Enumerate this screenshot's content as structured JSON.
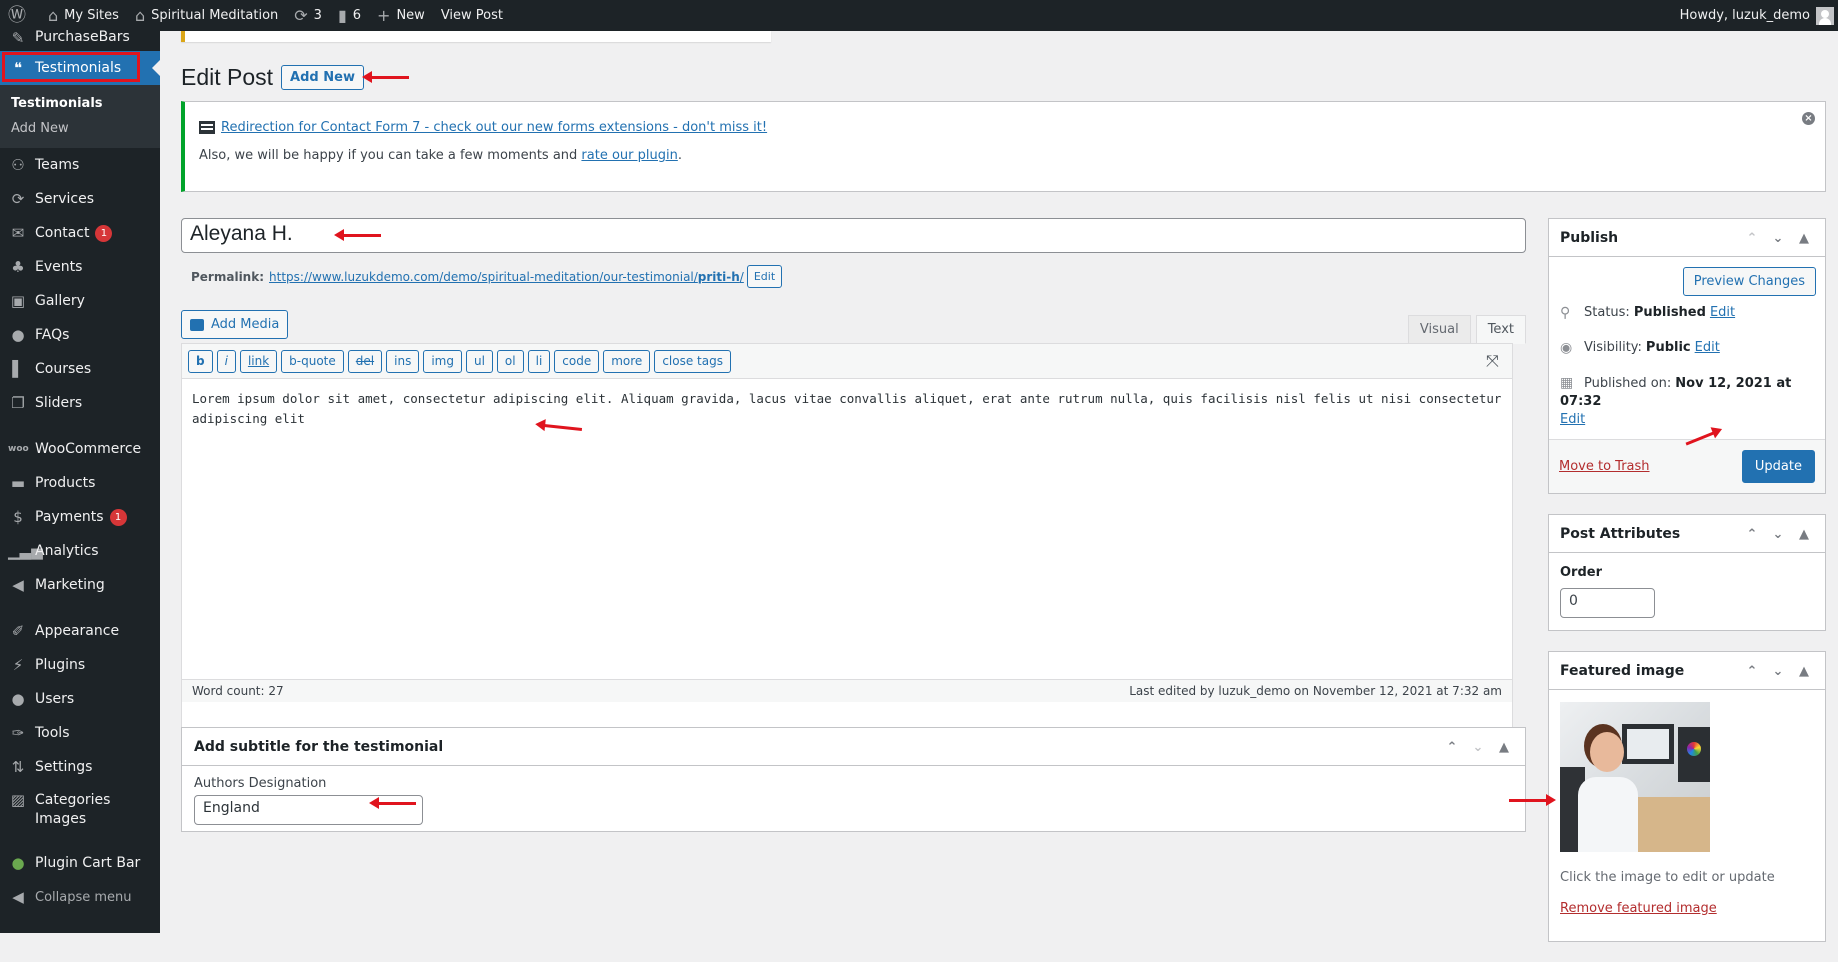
{
  "adminbar": {
    "wp_logo": "wordpress-logo-icon",
    "my_sites": "My Sites",
    "site_name": "Spiritual Meditation",
    "updates_count": "3",
    "comments_count": "6",
    "new_label": "New",
    "view_post": "View Post",
    "howdy": "Howdy, luzuk_demo"
  },
  "sidebar": {
    "items_top": [
      {
        "label": "PurchaseBars",
        "icon": "pushpin-icon"
      }
    ],
    "current": {
      "label": "Testimonials",
      "icon": "testimonial-icon"
    },
    "submenu": [
      "Testimonials",
      "Add New"
    ],
    "items_group1": [
      {
        "label": "Teams",
        "icon": "groups-icon"
      },
      {
        "label": "Services",
        "icon": "update-icon"
      },
      {
        "label": "Contact",
        "icon": "email-icon",
        "badge": "1"
      },
      {
        "label": "Events",
        "icon": "palmtree-icon"
      },
      {
        "label": "Gallery",
        "icon": "media-icon"
      },
      {
        "label": "FAQs",
        "icon": "chat-icon"
      },
      {
        "label": "Courses",
        "icon": "book-icon"
      },
      {
        "label": "Sliders",
        "icon": "slides-icon"
      }
    ],
    "items_group2": [
      {
        "label": "WooCommerce",
        "icon": "woo-icon"
      },
      {
        "label": "Products",
        "icon": "archive-icon"
      },
      {
        "label": "Payments",
        "icon": "money-icon",
        "badge": "1"
      },
      {
        "label": "Analytics",
        "icon": "chart-bar-icon"
      },
      {
        "label": "Marketing",
        "icon": "megaphone-icon"
      }
    ],
    "items_group3": [
      {
        "label": "Appearance",
        "icon": "brush-icon"
      },
      {
        "label": "Plugins",
        "icon": "plugin-icon"
      },
      {
        "label": "Users",
        "icon": "user-icon"
      },
      {
        "label": "Tools",
        "icon": "wrench-icon"
      },
      {
        "label": "Settings",
        "icon": "settings-icon"
      },
      {
        "label": "Categories Images",
        "icon": "image-icon"
      }
    ],
    "plugin_cart_bar": "Plugin Cart Bar",
    "collapse": "Collapse menu"
  },
  "header": {
    "title": "Edit Post",
    "add_new": "Add New"
  },
  "notice": {
    "link_text": "Redirection for Contact Form 7 - check out our new forms extensions - don't miss it!",
    "line2_prefix": "Also, we will be happy if you can take a few moments and ",
    "line2_link": "rate our plugin",
    "line2_suffix": "."
  },
  "post": {
    "title": "Aleyana H.",
    "permalink_label": "Permalink:",
    "permalink_base": "https://www.luzukdemo.com/demo/spiritual-meditation/our-testimonial/",
    "permalink_slug": "priti-h",
    "permalink_trailing": "/",
    "permalink_edit": "Edit",
    "add_media": "Add Media",
    "tab_visual": "Visual",
    "tab_text": "Text",
    "quicktags": [
      "b",
      "i",
      "link",
      "b-quote",
      "del",
      "ins",
      "img",
      "ul",
      "ol",
      "li",
      "code",
      "more",
      "close tags"
    ],
    "content": "Lorem ipsum dolor sit amet, consectetur adipiscing elit. Aliquam gravida, lacus vitae convallis aliquet, erat ante rutrum nulla, quis facilisis nisl felis ut nisi consectetur adipiscing elit",
    "word_count": "Word count: 27",
    "last_edited": "Last edited by luzuk_demo on November 12, 2021 at 7:32 am"
  },
  "subtitle_box": {
    "title": "Add subtitle for the testimonial",
    "field_label": "Authors Designation",
    "field_value": "England"
  },
  "publish": {
    "title": "Publish",
    "preview": "Preview Changes",
    "status_label": "Status:",
    "status_value": "Published",
    "visibility_label": "Visibility:",
    "visibility_value": "Public",
    "published_label": "Published on:",
    "published_value": "Nov 12, 2021 at 07:32",
    "edit": "Edit",
    "trash": "Move to Trash",
    "update": "Update"
  },
  "attributes": {
    "title": "Post Attributes",
    "order_label": "Order",
    "order_value": "0"
  },
  "featured": {
    "title": "Featured image",
    "caption": "Click the image to edit or update",
    "remove": "Remove featured image"
  },
  "colors": {
    "accent": "#2271b1",
    "adminbar_bg": "#1d2327",
    "annotation_red": "#e0141e",
    "notice_success": "#00a32a",
    "danger": "#b32d2e"
  }
}
